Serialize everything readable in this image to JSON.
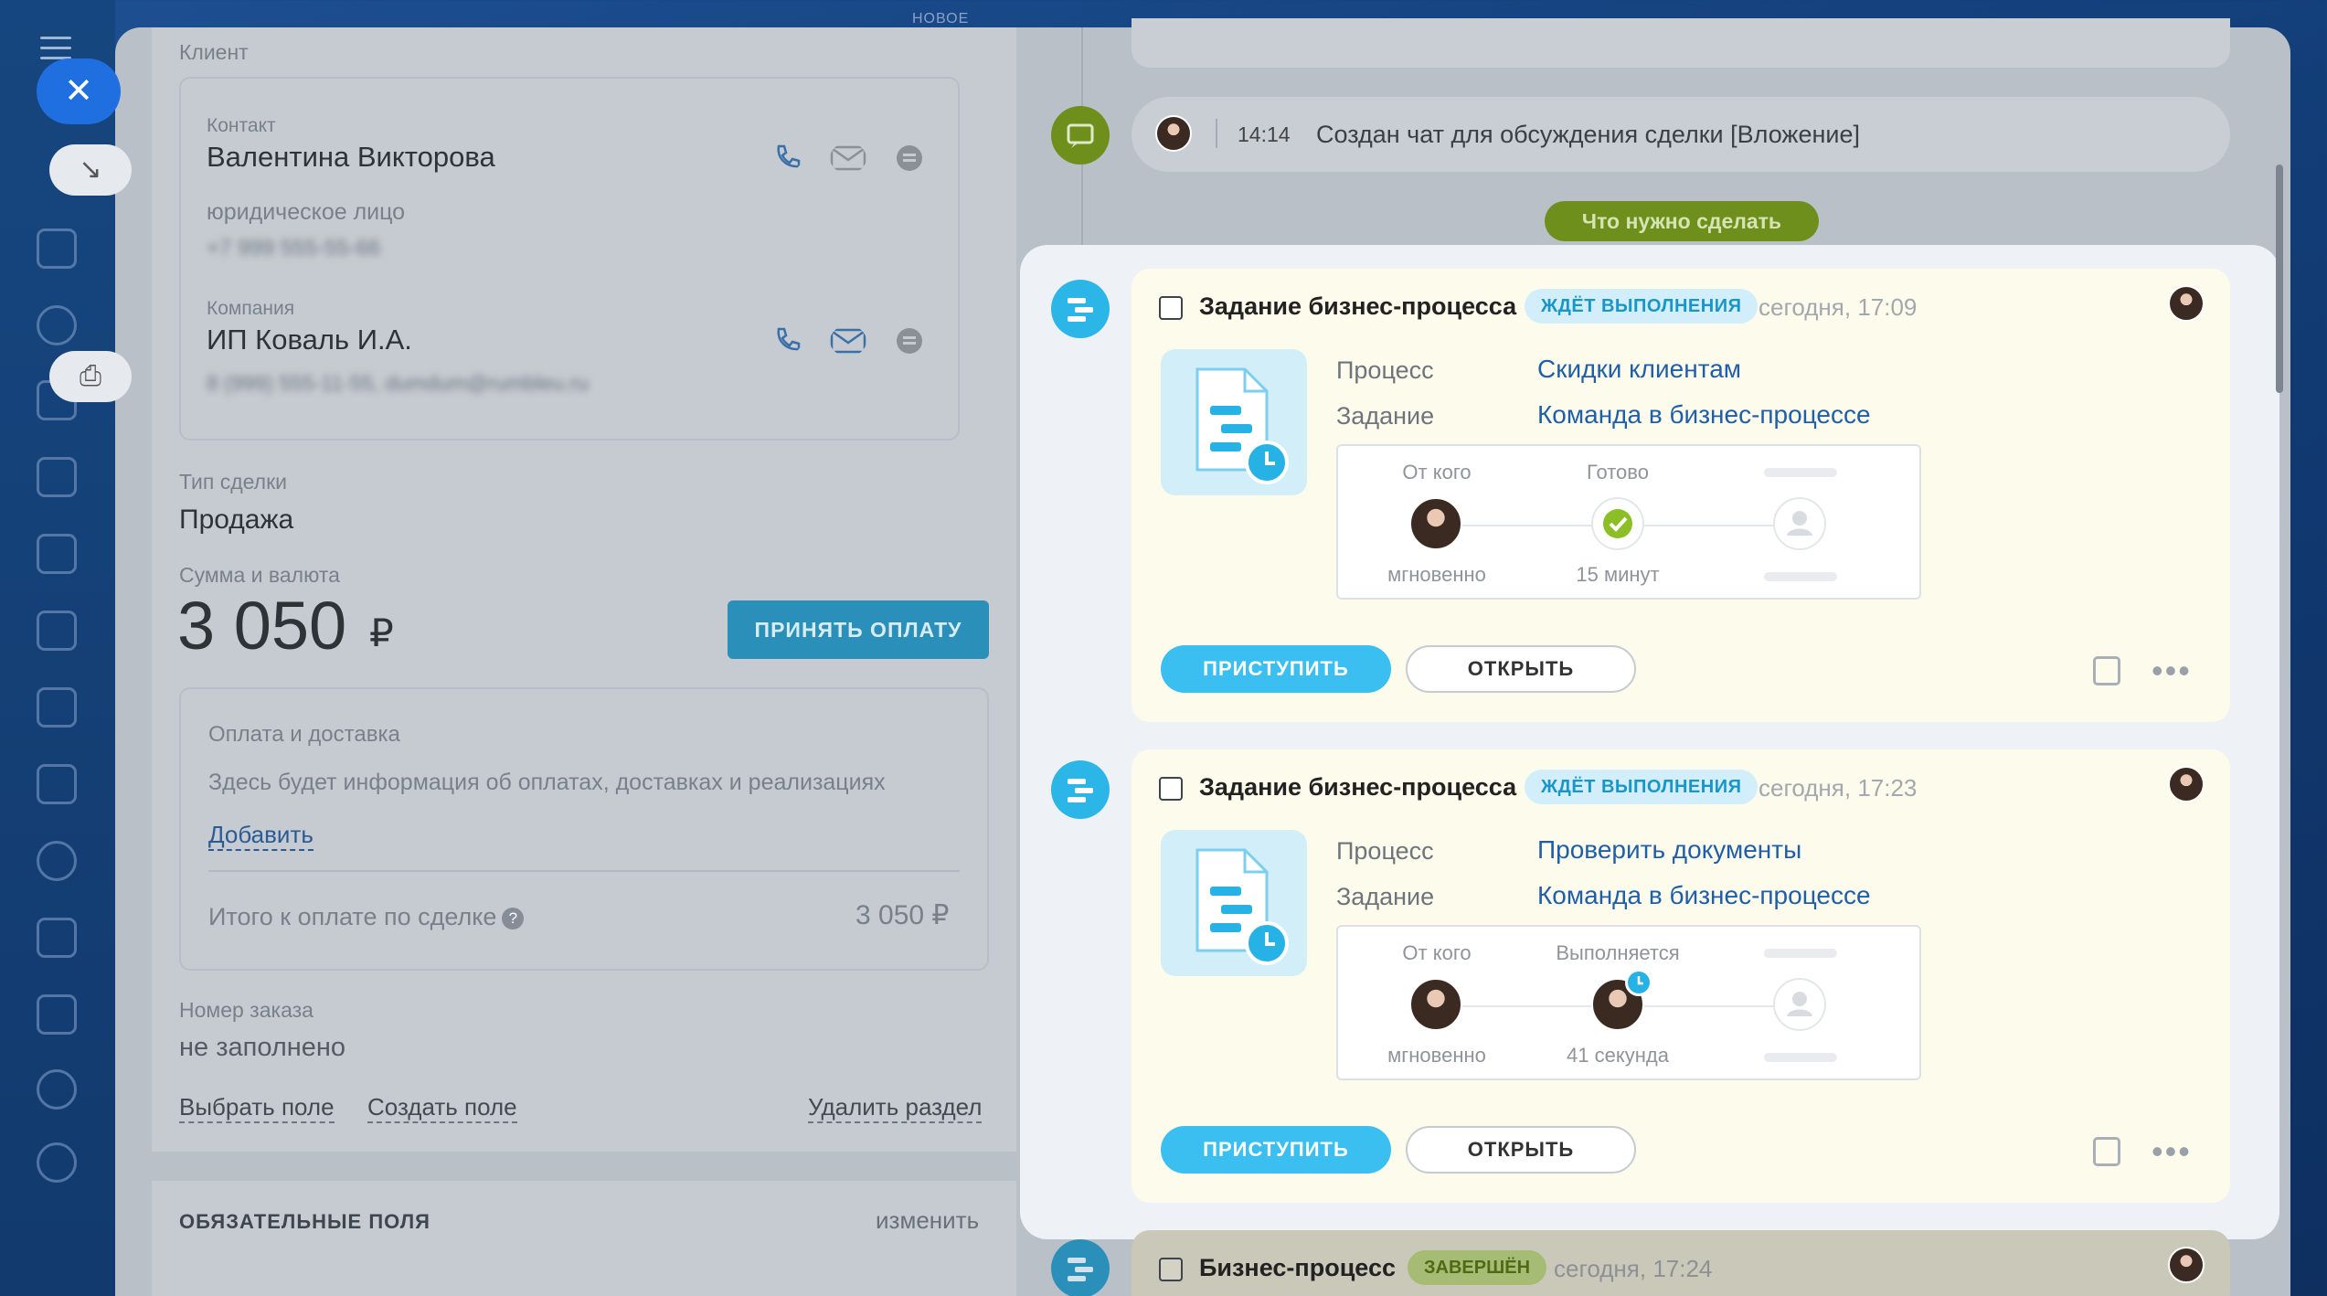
{
  "header": {
    "top_label": "НОВОЕ"
  },
  "client": {
    "section_label": "Клиент",
    "contact_label": "Контакт",
    "contact_name": "Валентина Викторова",
    "contact_type": "юридическое лицо",
    "contact_phone": "+7 999 555-55-66",
    "company_label": "Компания",
    "company_name": "ИП Коваль И.А.",
    "company_details": "8 (999) 555-11-55, dumdum@rumbleu.ru"
  },
  "deal": {
    "type_label": "Тип сделки",
    "type_value": "Продажа",
    "sum_label": "Сумма и валюта",
    "sum_value": "3 050",
    "currency": "₽",
    "accept_button": "ПРИНЯТЬ ОПЛАТУ"
  },
  "payment": {
    "title": "Оплата и доставка",
    "info": "Здесь будет информация об оплатах, доставках и реализациях",
    "add_link": "Добавить",
    "total_label": "Итого к оплате по сделке",
    "total_value": "3 050 ₽"
  },
  "order": {
    "label": "Номер заказа",
    "value": "не заполнено",
    "choose_field": "Выбрать поле",
    "create_field": "Создать поле",
    "delete_section": "Удалить раздел"
  },
  "required": {
    "title": "ОБЯЗАТЕЛЬНЫЕ ПОЛЯ",
    "edit": "изменить"
  },
  "timeline": {
    "chat_time": "14:14",
    "chat_text": "Создан чат для обсуждения сделки [Вложение]",
    "todo_label": "Что нужно сделать",
    "cards": [
      {
        "title": "Задание бизнес-процесса",
        "badge": "ЖДЁТ ВЫПОЛНЕНИЯ",
        "time": "сегодня, 17:09",
        "process_label": "Процесс",
        "process_value": "Скидки клиентам",
        "task_label": "Задание",
        "task_value": "Команда в бизнес-процессе",
        "from_label": "От кого",
        "from_sub": "мгновенно",
        "mid_label": "Готово",
        "mid_sub": "15 минут",
        "start_button": "ПРИСТУПИТЬ",
        "open_button": "ОТКРЫТЬ"
      },
      {
        "title": "Задание бизнес-процесса",
        "badge": "ЖДЁТ ВЫПОЛНЕНИЯ",
        "time": "сегодня, 17:23",
        "process_label": "Процесс",
        "process_value": "Проверить документы",
        "task_label": "Задание",
        "task_value": "Команда в бизнес-процессе",
        "from_label": "От кого",
        "from_sub": "мгновенно",
        "mid_label": "Выполняется",
        "mid_sub": "41 секунда",
        "start_button": "ПРИСТУПИТЬ",
        "open_button": "ОТКРЫТЬ"
      }
    ],
    "bottom_card": {
      "title": "Бизнес-процесс",
      "badge": "ЗАВЕРШЁН",
      "time": "сегодня, 17:24"
    }
  },
  "colors": {
    "accent": "#2cb6e8",
    "success": "#8cbf26",
    "primary_button": "#3bbff0"
  }
}
